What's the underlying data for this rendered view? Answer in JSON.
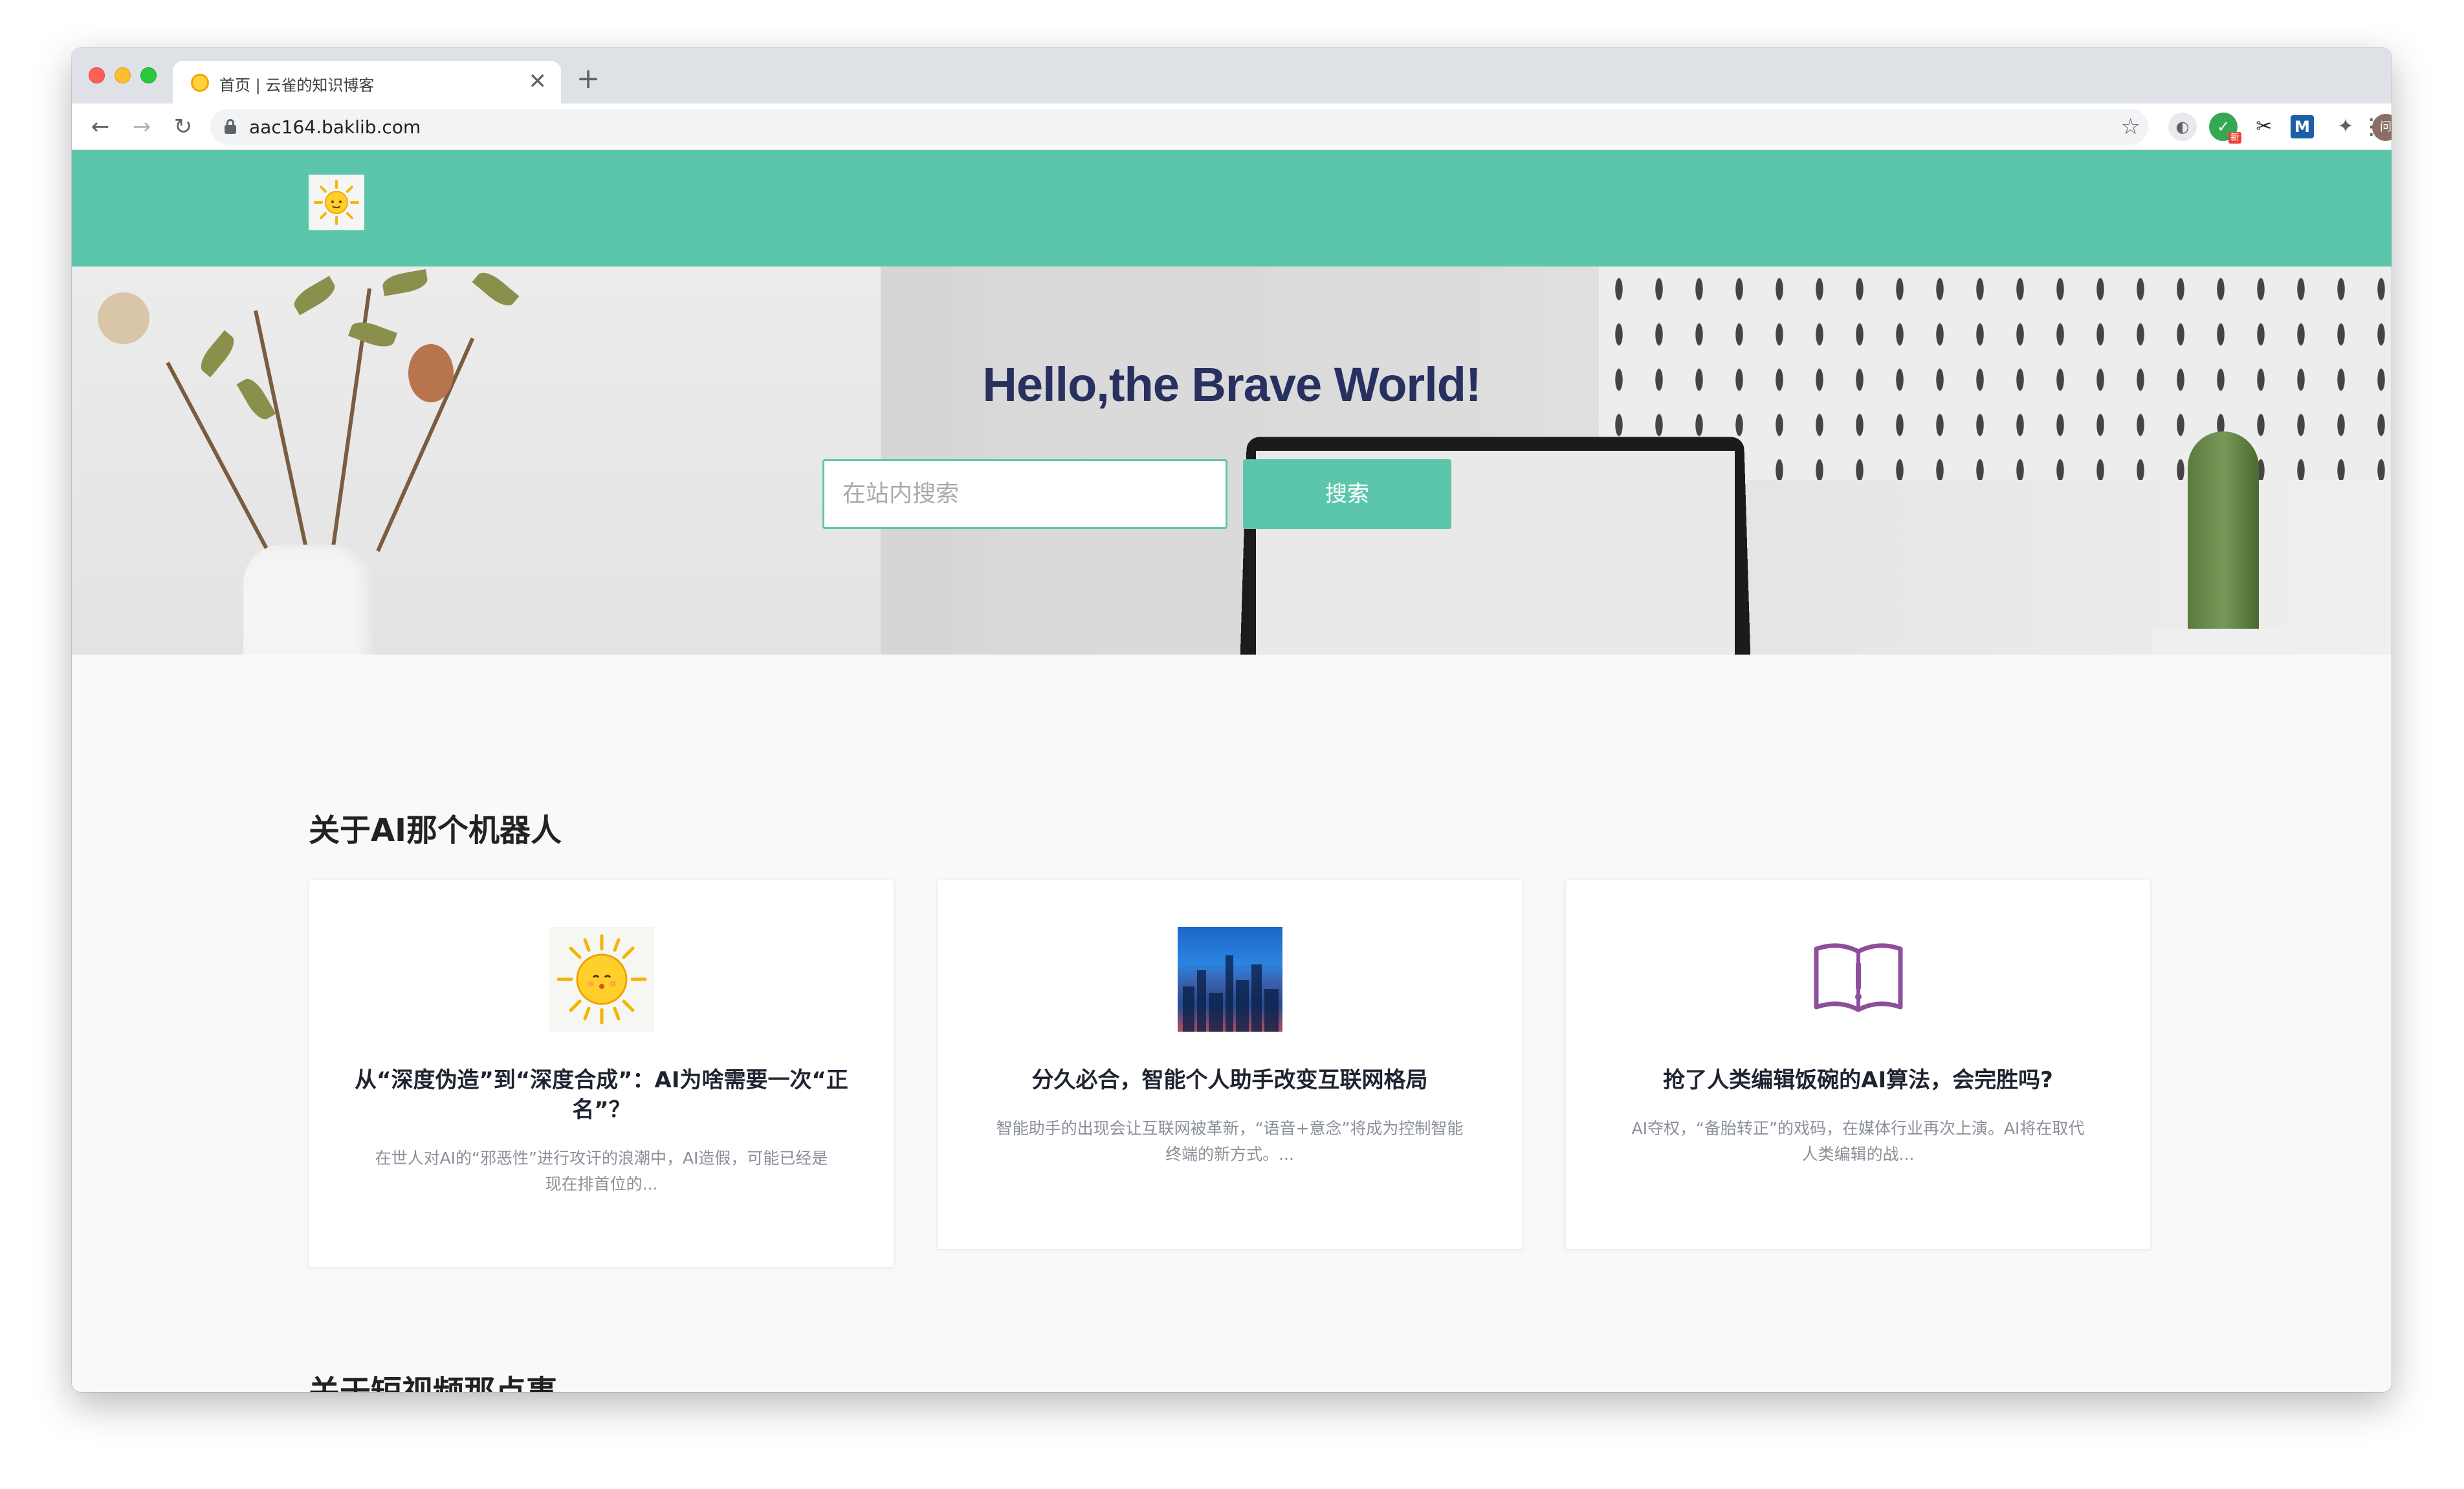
{
  "browser": {
    "tab_title": "首页 | 云雀的知识博客",
    "tab_close": "✕",
    "new_tab": "+",
    "url": "aac164.baklib.com",
    "nav_back": "←",
    "nav_forward": "→",
    "nav_reload": "↻",
    "bookmark_star": "☆",
    "ext_badge": "新",
    "ext_m_label": "M",
    "avatar_label": "问",
    "menu_glyph": "⋮"
  },
  "site": {
    "header_color": "#5cc6ab",
    "hero_title": "Hello,the Brave World!",
    "search": {
      "placeholder": "在站内搜索",
      "button_label": "搜索"
    }
  },
  "sections": [
    {
      "title": "关于AI那个机器人",
      "cards": [
        {
          "icon": "sun-image",
          "title": "从“深度伪造”到“深度合成”：AI为啥需要一次“正名”？",
          "description": "在世人对AI的“邪恶性”进行攻讦的浪潮中，AI造假，可能已经是现在排首位的..."
        },
        {
          "icon": "city-image",
          "title": "分久必合，智能个人助手改变互联网格局",
          "description": "智能助手的出现会让互联网被革新，“语音+意念”将成为控制智能终端的新方式。..."
        },
        {
          "icon": "book-exclamation-icon",
          "title": "抢了人类编辑饭碗的AI算法，会完胜吗?",
          "description": "AI夺权，“备胎转正”的戏码，在媒体行业再次上演。AI将在取代人类编辑的战..."
        }
      ]
    },
    {
      "title": "关于短视频那点事"
    }
  ]
}
